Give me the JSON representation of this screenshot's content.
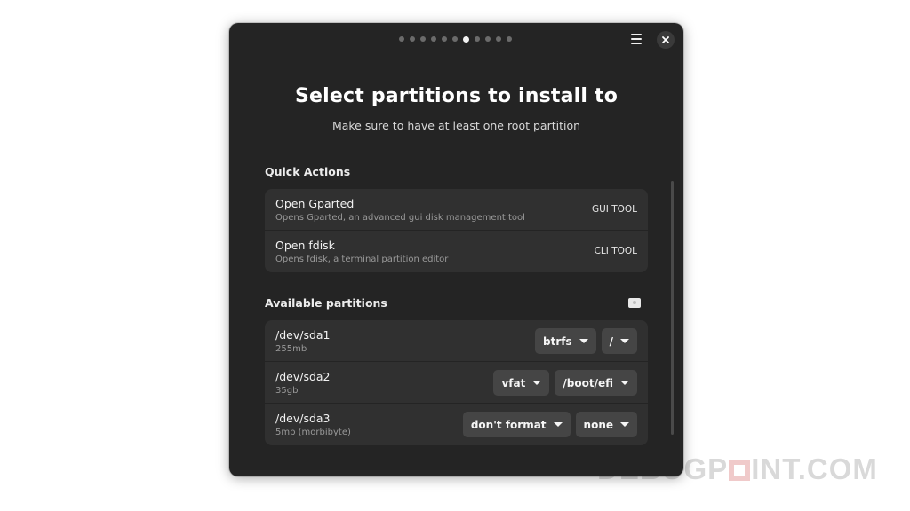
{
  "pager": {
    "total": 11,
    "active_index": 6
  },
  "header": {
    "menu_icon": "hamburger-menu-icon",
    "close_icon": "close-icon"
  },
  "title": "Select partitions to install to",
  "subtitle": "Make sure to have at least one root partition",
  "quick_actions": {
    "label": "Quick Actions",
    "items": [
      {
        "title": "Open Gparted",
        "description": "Opens Gparted, an advanced gui disk management tool",
        "suffix": "GUI TOOL"
      },
      {
        "title": "Open fdisk",
        "description": "Opens fdisk, a terminal partition editor",
        "suffix": "CLI TOOL"
      }
    ]
  },
  "partitions": {
    "label": "Available partitions",
    "refresh_icon": "drive-icon",
    "items": [
      {
        "device": "/dev/sda1",
        "size": "255mb",
        "format": "btrfs",
        "mount": "/"
      },
      {
        "device": "/dev/sda2",
        "size": "35gb",
        "format": "vfat",
        "mount": "/boot/efi"
      },
      {
        "device": "/dev/sda3",
        "size": "5mb (morbibyte)",
        "format": "don't format",
        "mount": "none"
      }
    ]
  },
  "watermark": {
    "prefix": "DEBUGP",
    "suffix": "INT.COM"
  }
}
